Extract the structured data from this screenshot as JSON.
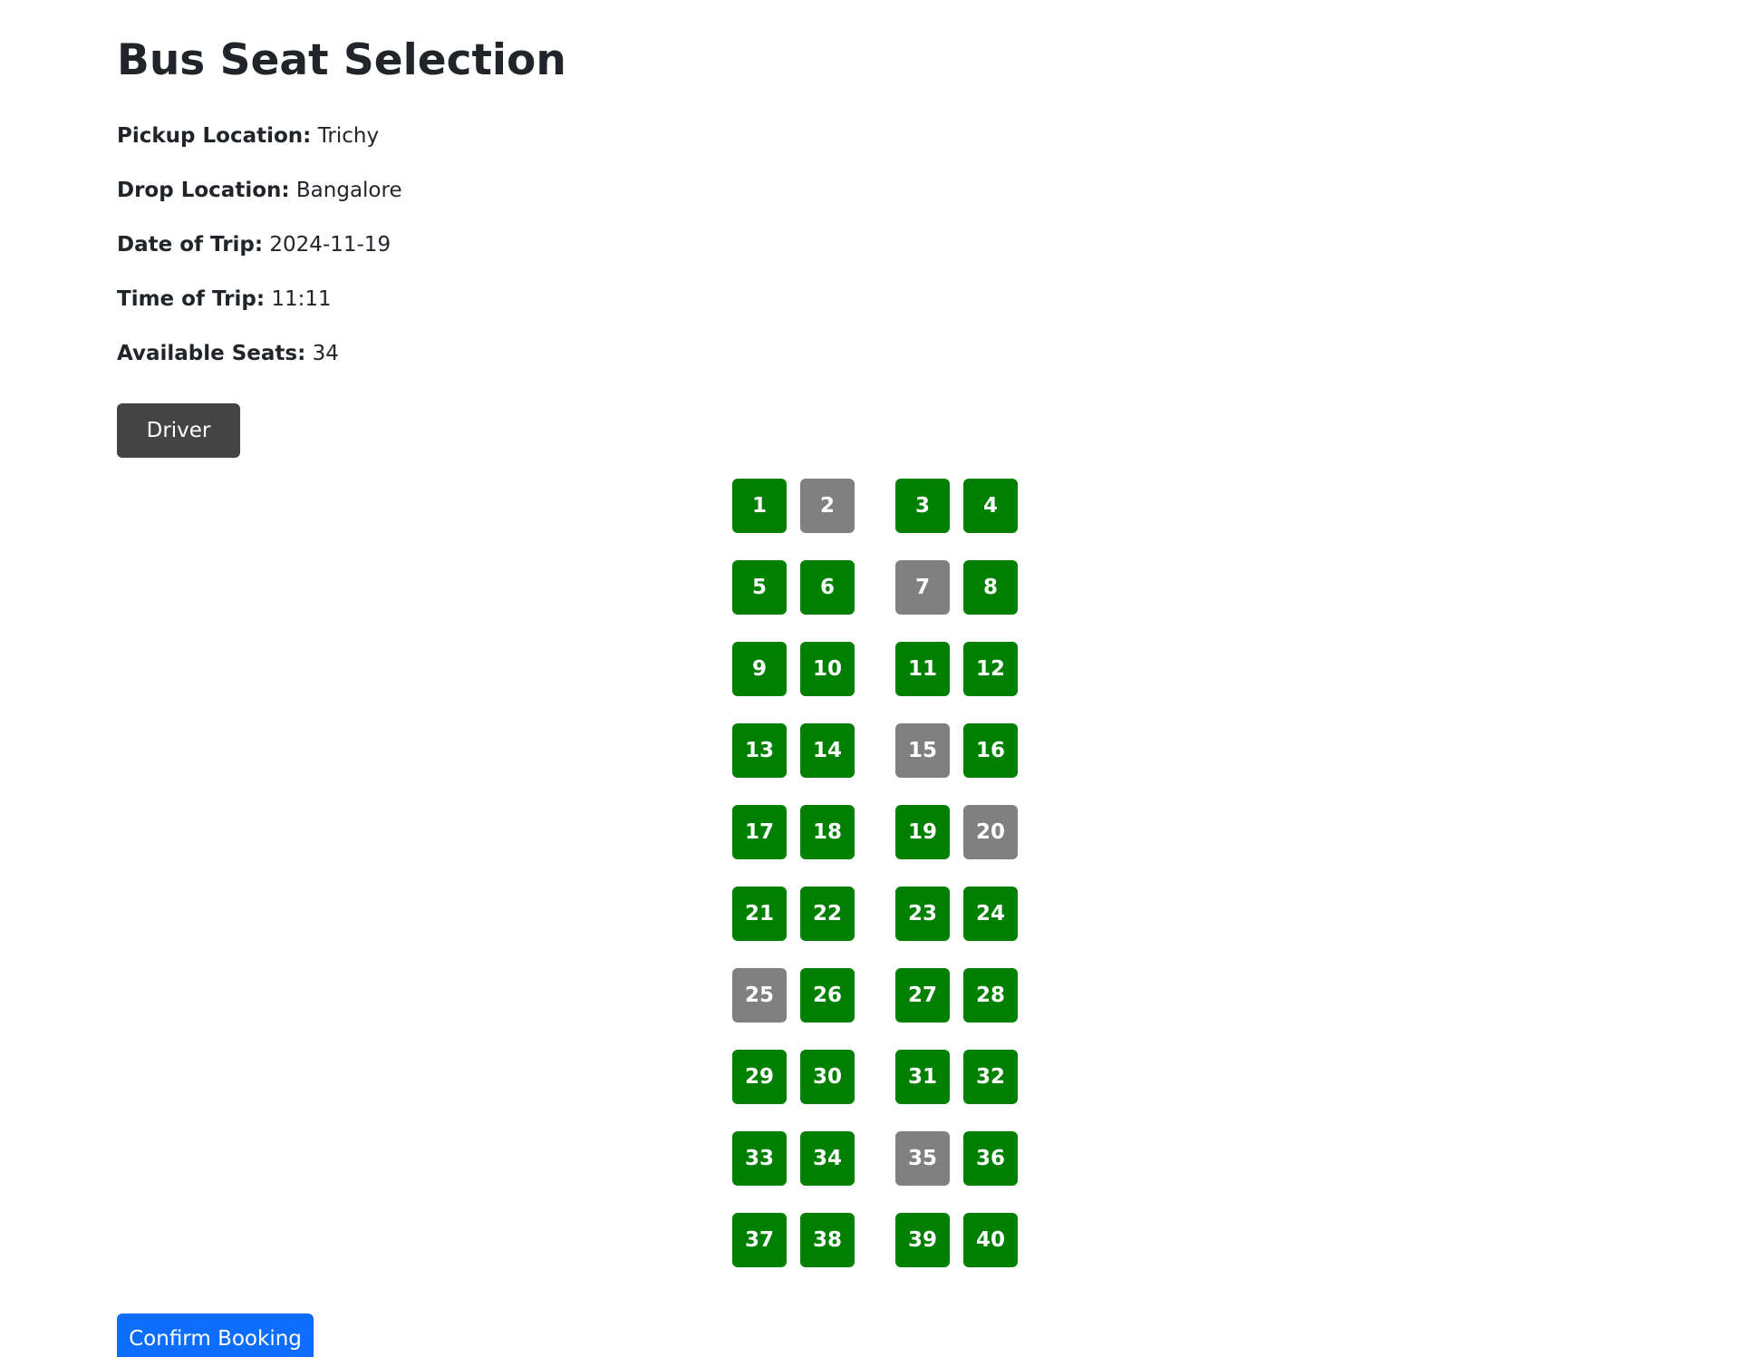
{
  "page": {
    "title": "Bus Seat Selection"
  },
  "trip": {
    "pickup_label": "Pickup Location:",
    "pickup_value": "Trichy",
    "drop_label": "Drop Location:",
    "drop_value": "Bangalore",
    "date_label": "Date of Trip:",
    "date_value": "2024-11-19",
    "time_label": "Time of Trip:",
    "time_value": "11:11",
    "available_label": "Available Seats:",
    "available_value": "34"
  },
  "driver": {
    "label": "Driver"
  },
  "colors": {
    "available": "#008000",
    "booked": "#808080",
    "driver": "#444444",
    "confirm": "#0d6efd"
  },
  "seats": [
    {
      "number": "1",
      "status": "available"
    },
    {
      "number": "2",
      "status": "booked"
    },
    {
      "number": "3",
      "status": "available"
    },
    {
      "number": "4",
      "status": "available"
    },
    {
      "number": "5",
      "status": "available"
    },
    {
      "number": "6",
      "status": "available"
    },
    {
      "number": "7",
      "status": "booked"
    },
    {
      "number": "8",
      "status": "available"
    },
    {
      "number": "9",
      "status": "available"
    },
    {
      "number": "10",
      "status": "available"
    },
    {
      "number": "11",
      "status": "available"
    },
    {
      "number": "12",
      "status": "available"
    },
    {
      "number": "13",
      "status": "available"
    },
    {
      "number": "14",
      "status": "available"
    },
    {
      "number": "15",
      "status": "booked"
    },
    {
      "number": "16",
      "status": "available"
    },
    {
      "number": "17",
      "status": "available"
    },
    {
      "number": "18",
      "status": "available"
    },
    {
      "number": "19",
      "status": "available"
    },
    {
      "number": "20",
      "status": "booked"
    },
    {
      "number": "21",
      "status": "available"
    },
    {
      "number": "22",
      "status": "available"
    },
    {
      "number": "23",
      "status": "available"
    },
    {
      "number": "24",
      "status": "available"
    },
    {
      "number": "25",
      "status": "booked"
    },
    {
      "number": "26",
      "status": "available"
    },
    {
      "number": "27",
      "status": "available"
    },
    {
      "number": "28",
      "status": "available"
    },
    {
      "number": "29",
      "status": "available"
    },
    {
      "number": "30",
      "status": "available"
    },
    {
      "number": "31",
      "status": "available"
    },
    {
      "number": "32",
      "status": "available"
    },
    {
      "number": "33",
      "status": "available"
    },
    {
      "number": "34",
      "status": "available"
    },
    {
      "number": "35",
      "status": "booked"
    },
    {
      "number": "36",
      "status": "available"
    },
    {
      "number": "37",
      "status": "available"
    },
    {
      "number": "38",
      "status": "available"
    },
    {
      "number": "39",
      "status": "available"
    },
    {
      "number": "40",
      "status": "available"
    }
  ],
  "actions": {
    "confirm_label": "Confirm Booking"
  }
}
